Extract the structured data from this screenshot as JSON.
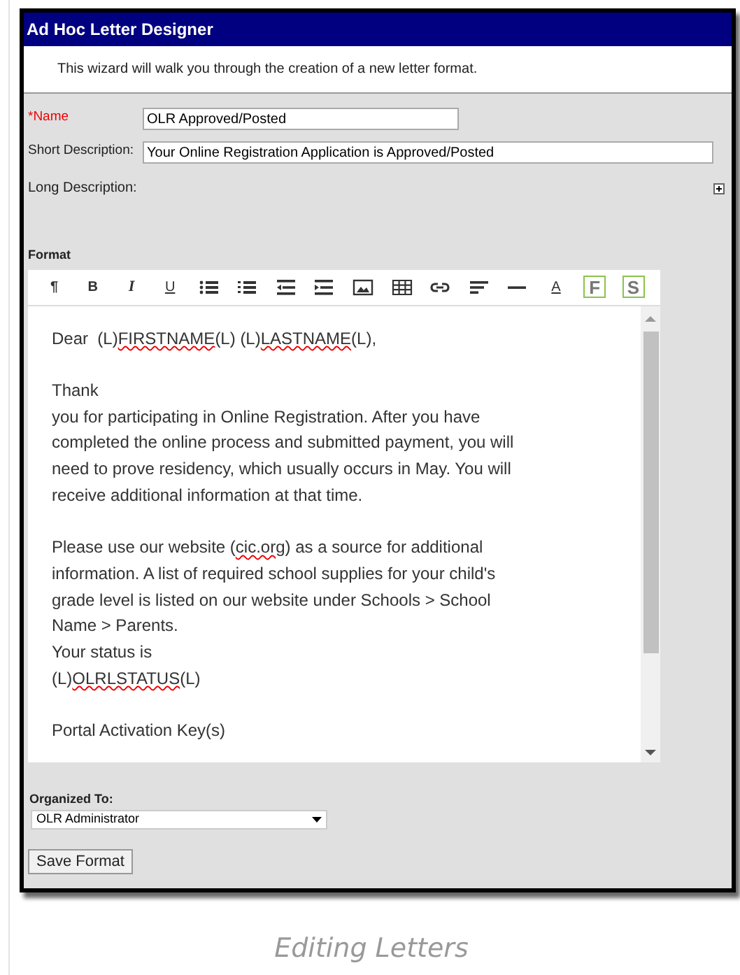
{
  "window": {
    "title": "Ad Hoc Letter Designer"
  },
  "intro": "This wizard will walk you through the creation of a new letter format.",
  "fields": [
    {
      "label": "*Name",
      "required": true,
      "value": "OLR Approved/Posted"
    },
    {
      "label": "Short Description:",
      "required": false,
      "value": "Your Online Registration Application is Approved/Posted"
    }
  ],
  "long_description": {
    "label": "Long Description:"
  },
  "format": {
    "label": "Format",
    "toolbar": [
      {
        "kind": "text",
        "text": "¶"
      },
      {
        "kind": "text",
        "text": "B"
      },
      {
        "kind": "text",
        "text": "I"
      },
      {
        "kind": "text",
        "text": "U"
      },
      {
        "kind": "icon"
      },
      {
        "kind": "icon"
      },
      {
        "kind": "icon"
      },
      {
        "kind": "icon"
      },
      {
        "kind": "icon"
      },
      {
        "kind": "icon"
      },
      {
        "kind": "icon"
      },
      {
        "kind": "icon"
      },
      {
        "kind": "icon"
      },
      {
        "kind": "text",
        "text": "A"
      },
      {
        "kind": "text",
        "text": "F"
      },
      {
        "kind": "text",
        "text": "S"
      }
    ],
    "paragraphs": [
      [
        [
          {
            "text": "Dear  (L)",
            "misspelled": false
          },
          {
            "text": "FIRSTNAME",
            "misspelled": true
          },
          {
            "text": "(L) (L)",
            "misspelled": false
          },
          {
            "text": "LASTNAME",
            "misspelled": true
          },
          {
            "text": "(L),",
            "misspelled": false
          }
        ]
      ],
      [
        [
          {
            "text": "Thank",
            "misspelled": false
          }
        ],
        [
          {
            "text": "you for participating in Online Registration. After you have",
            "misspelled": false
          }
        ],
        [
          {
            "text": "completed the online process and submitted payment, you will",
            "misspelled": false
          }
        ],
        [
          {
            "text": "need to prove residency, which usually occurs in May. You will",
            "misspelled": false
          }
        ],
        [
          {
            "text": "receive additional information at that time.",
            "misspelled": false
          }
        ]
      ],
      [
        [
          {
            "text": "Please use our website (",
            "misspelled": false
          },
          {
            "text": "cic.org",
            "misspelled": true
          },
          {
            "text": ") as a source for additional",
            "misspelled": false
          }
        ],
        [
          {
            "text": "information. A list of required school supplies for your child's",
            "misspelled": false
          }
        ],
        [
          {
            "text": "grade level is listed on our website under Schools > School",
            "misspelled": false
          }
        ],
        [
          {
            "text": "Name > Parents.",
            "misspelled": false
          }
        ],
        [
          {
            "text": "Your status is",
            "misspelled": false
          }
        ],
        [
          {
            "text": "(L)",
            "misspelled": false
          },
          {
            "text": "OLRLSTATUS",
            "misspelled": true
          },
          {
            "text": "(L)",
            "misspelled": false
          }
        ]
      ],
      [
        [
          {
            "text": "Portal Activation Key(s)",
            "misspelled": false
          }
        ]
      ]
    ]
  },
  "organized_to": {
    "label": "Organized To:",
    "value": "OLR Administrator"
  },
  "save_button": "Save Format",
  "caption": "Editing Letters"
}
